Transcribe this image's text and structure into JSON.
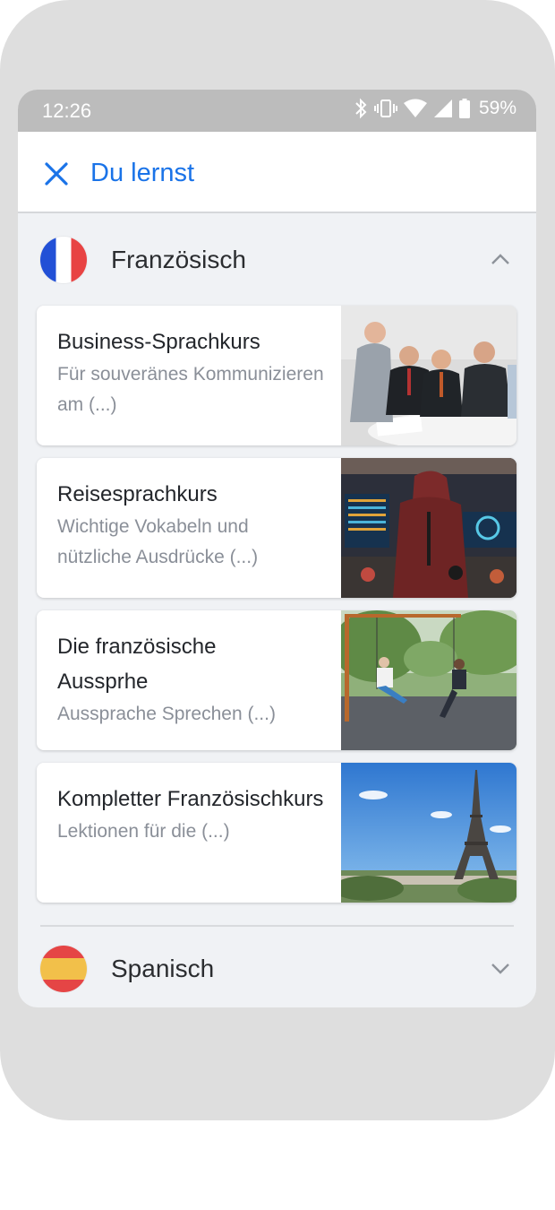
{
  "status_bar": {
    "time": "12:26",
    "battery": "59%"
  },
  "header": {
    "title": "Du lernst",
    "close_icon": "close-icon"
  },
  "languages": [
    {
      "name": "Französisch",
      "flag": "flag-france",
      "expanded": true,
      "courses": [
        {
          "title": "Business-Sprachkurs",
          "subtitle": "Für souveränes Kommunizieren am (...)",
          "image": "business-meeting-photo"
        },
        {
          "title": "Reisesprachkurs",
          "subtitle": "Wichtige Vokabeln und nützliche Ausdrücke (...)",
          "image": "airport-traveler-photo"
        },
        {
          "title": "Die französische Aussprhe",
          "subtitle": "Aussprache Sprechen (...)",
          "image": "park-swings-photo"
        },
        {
          "title": "Kompletter Französischkurs",
          "subtitle": "Lektionen für die (...)",
          "image": "eiffel-tower-photo"
        }
      ]
    },
    {
      "name": "Spanisch",
      "flag": "flag-spain",
      "expanded": false
    }
  ],
  "colors": {
    "accent": "#1a73e8",
    "background": "#f0f2f5",
    "status_bar": "#bcbcbc"
  }
}
